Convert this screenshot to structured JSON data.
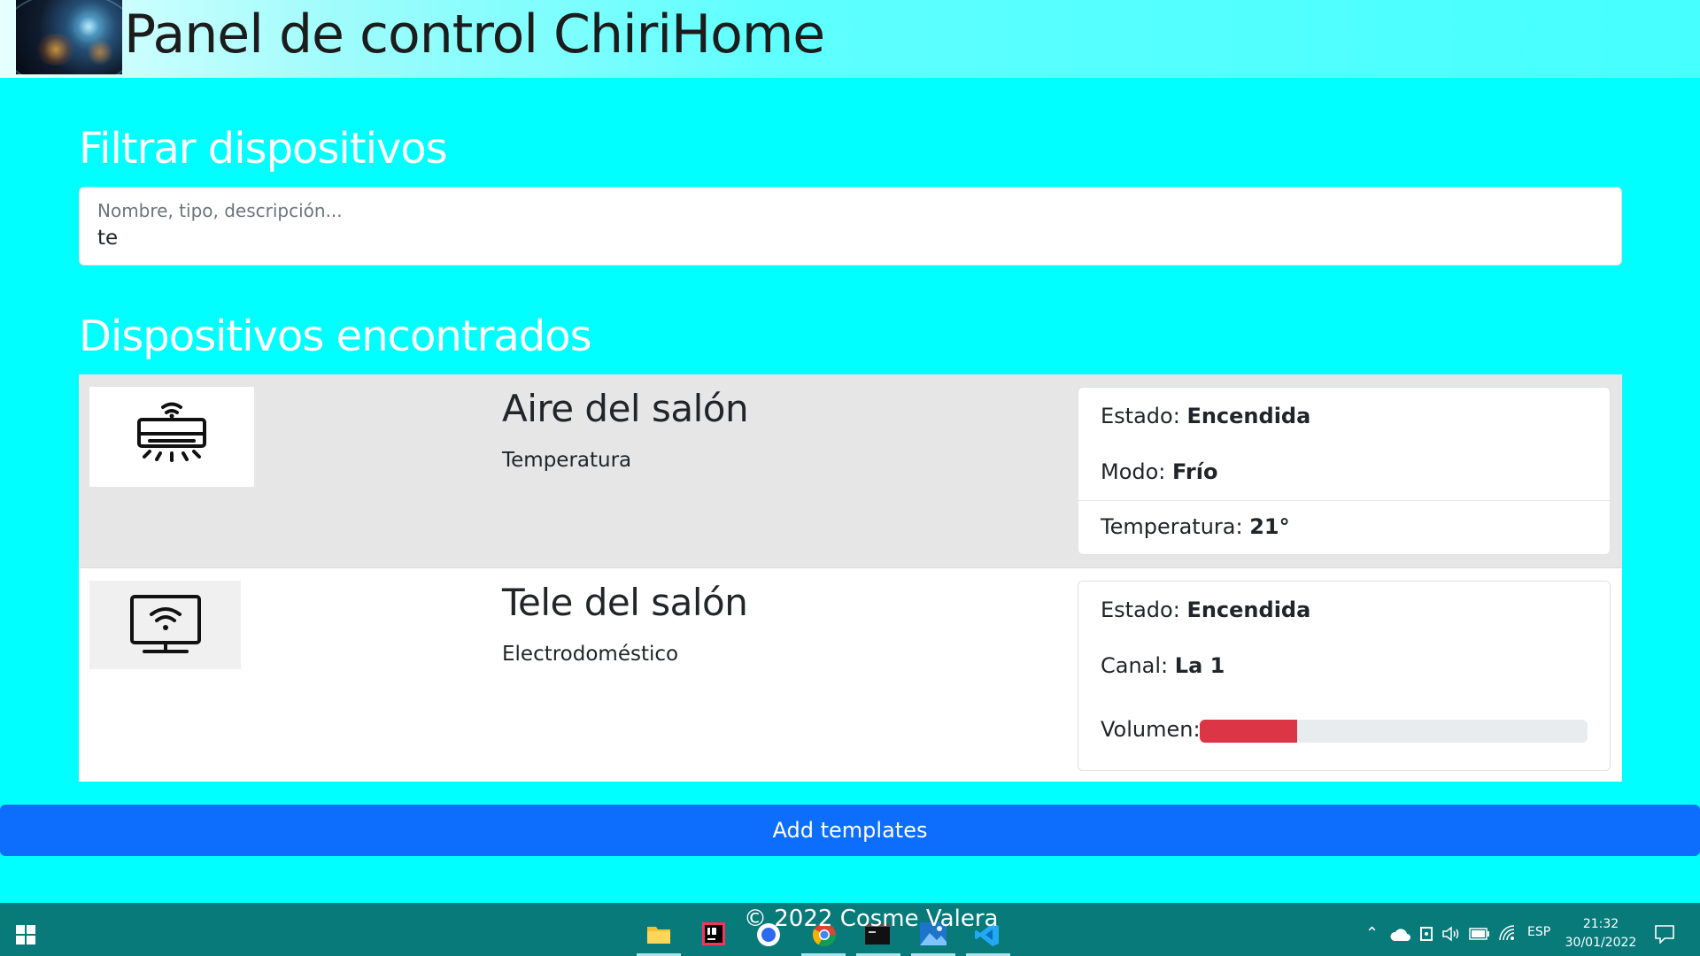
{
  "header": {
    "title": "Panel de control ChiriHome",
    "logo_icon": "globe-network-icon"
  },
  "filter": {
    "title": "Filtrar dispositivos",
    "placeholder": "Nombre, tipo, descripción...",
    "value": "te"
  },
  "devices": {
    "title": "Dispositivos encontrados",
    "items": [
      {
        "name": "Aire del salón",
        "type": "Temperatura",
        "icon": "air-conditioner-icon",
        "props": [
          {
            "label": "Estado:",
            "value": "Encendida"
          },
          {
            "label": "Modo:",
            "value": "Frío"
          },
          {
            "label": "Temperatura:",
            "value": "21°"
          }
        ]
      },
      {
        "name": "Tele del salón",
        "type": "Electrodoméstico",
        "icon": "smart-tv-icon",
        "props": [
          {
            "label": "Estado:",
            "value": "Encendida"
          },
          {
            "label": "Canal:",
            "value": "La 1"
          },
          {
            "label": "Volumen:",
            "value": ""
          }
        ],
        "volume_percent": 25,
        "volume_color": "#dc3545"
      }
    ]
  },
  "actions": {
    "add_templates": "Add templates"
  },
  "footer": {
    "text": "© 2022 Cosme Valera"
  },
  "taskbar": {
    "start_icon": "windows-start-icon",
    "apps": [
      "file-explorer-icon",
      "intellij-icon",
      "signal-app-icon",
      "chrome-icon",
      "terminal-icon",
      "photos-icon",
      "vscode-icon"
    ],
    "tray": {
      "language": "ESP",
      "time": "21:32",
      "date": "30/01/2022"
    }
  },
  "colors": {
    "background": "#00ffff",
    "primary_button": "#0d6efd",
    "taskbar": "#087a7a"
  }
}
